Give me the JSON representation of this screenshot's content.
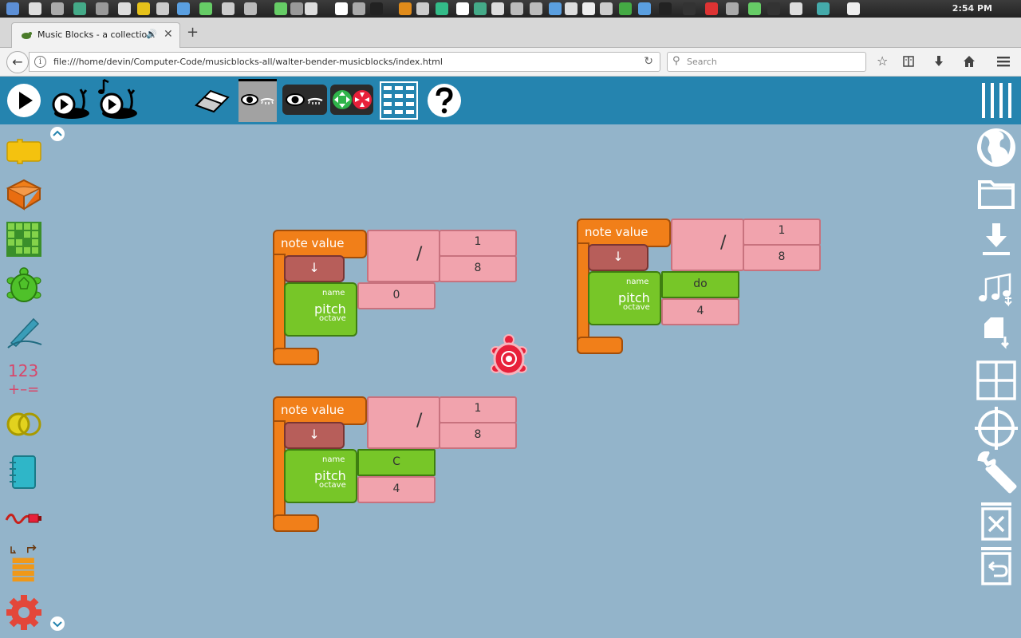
{
  "taskbar": {
    "clock": "2:54 PM",
    "icon_colors": [
      "#5c8fd6",
      "#ddd",
      "#aaa",
      "#4a8",
      "#999",
      "#ddd",
      "#e6c21a",
      "#ccc",
      "#5a9fe0",
      "#6c6",
      "#ccc",
      "#bbb",
      "#6c6",
      "#999",
      "#ddd",
      "#fff",
      "#aaa",
      "#222",
      "#e08b1a",
      "#ccc",
      "#3b8",
      "#fff",
      "#4a8",
      "#ddd",
      "#bbb",
      "#bbb",
      "#5a9fe0",
      "#ddd",
      "#eee",
      "#ccc",
      "#4a4",
      "#5a9fe0",
      "#222",
      "#333",
      "#d33",
      "#aaa",
      "#6c6",
      "#333",
      "#ddd",
      "#4aa",
      "#eee"
    ]
  },
  "browser": {
    "tab_title": "Music Blocks - a collectio...",
    "new_tab": "+",
    "close": "✕",
    "url": "file:///home/devin/Computer-Code/musicblocks-all/walter-bender-musicblocks/index.html",
    "search_placeholder": "Search",
    "info": "i",
    "back": "←",
    "reload": "↻"
  },
  "blocks": [
    {
      "label": "note value",
      "numerator": "1",
      "denominator": "8",
      "divide": "/",
      "arrow": "↓",
      "pitch": {
        "name_label": "name",
        "big_label": "pitch",
        "octave_label": "octave",
        "name_value": "0",
        "octave_value": null,
        "name_style": "pink"
      }
    },
    {
      "label": "note value",
      "numerator": "1",
      "denominator": "8",
      "divide": "/",
      "arrow": "↓",
      "pitch": {
        "name_label": "name",
        "big_label": "pitch",
        "octave_label": "octave",
        "name_value": "do",
        "octave_value": "4",
        "name_style": "green"
      }
    },
    {
      "label": "note value",
      "numerator": "1",
      "denominator": "8",
      "divide": "/",
      "arrow": "↓",
      "pitch": {
        "name_label": "name",
        "big_label": "pitch",
        "octave_label": "octave",
        "name_value": "C",
        "octave_value": "4",
        "name_style": "green"
      }
    }
  ],
  "colors": {
    "toolbar": "#2584af",
    "canvas": "#93b4ca",
    "note_value": "#f17f19",
    "number": "#f1a3ad",
    "pitch": "#77c628",
    "turtle": "#e8203a"
  }
}
